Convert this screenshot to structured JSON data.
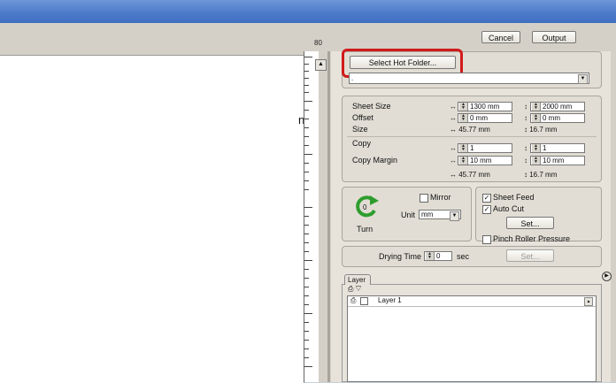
{
  "top_buttons": {
    "cancel": "Cancel",
    "output": "Output"
  },
  "hot_folder": {
    "button": "Select Hot Folder...",
    "value": "."
  },
  "ruler": {
    "top_number": "80"
  },
  "canvas": {
    "partial_text": "n"
  },
  "sheet": {
    "sheet_size_label": "Sheet Size",
    "sheet_w": "1300 mm",
    "sheet_h": "2000 mm",
    "offset_label": "Offset",
    "offset_x": "0 mm",
    "offset_y": "0 mm",
    "size_label": "Size",
    "size_w": "45.77 mm",
    "size_h": "16.7 mm",
    "copy_label": "Copy",
    "copy_x": "1",
    "copy_y": "1",
    "copy_margin_label": "Copy Margin",
    "margin_x": "10 mm",
    "margin_y": "10 mm",
    "total_w": "45.77 mm",
    "total_h": "16.7 mm"
  },
  "transform": {
    "mirror": "Mirror",
    "unit_label": "Unit",
    "unit_value": "mm",
    "turn": "Turn",
    "turn_value": "0"
  },
  "options": {
    "sheet_feed": "Sheet Feed",
    "auto_cut": "Auto Cut",
    "set": "Set...",
    "pinch": "Pinch Roller Pressure"
  },
  "drying": {
    "label": "Drying Time",
    "value": "0",
    "unit": "sec",
    "set": "Set..."
  },
  "layer": {
    "tab": "Layer",
    "row_name": "Layer 1"
  }
}
